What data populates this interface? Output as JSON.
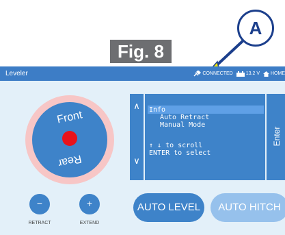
{
  "figure": {
    "label": "Fig. 8",
    "callout": "A"
  },
  "app": {
    "title": "Leveler"
  },
  "status": {
    "connection": "CONNECTED",
    "voltage": "13.2 V",
    "home": "HOME"
  },
  "dial": {
    "front": "Front",
    "rear": "Rear"
  },
  "controls": {
    "retract_symbol": "−",
    "extend_symbol": "+",
    "retract_label": "RETRACT",
    "extend_label": "EXTEND"
  },
  "menu": {
    "up_arrow": "∧",
    "down_arrow": "∨",
    "items": [
      "Info",
      "Auto Retract",
      "Manual Mode"
    ],
    "selected_index": 0,
    "hint_scroll": "↑ ↓ to scroll",
    "hint_enter": "ENTER to select",
    "enter_label": "Enter"
  },
  "buttons": {
    "auto_level": "AUTO LEVEL",
    "auto_hitch": "AUTO HITCH"
  }
}
